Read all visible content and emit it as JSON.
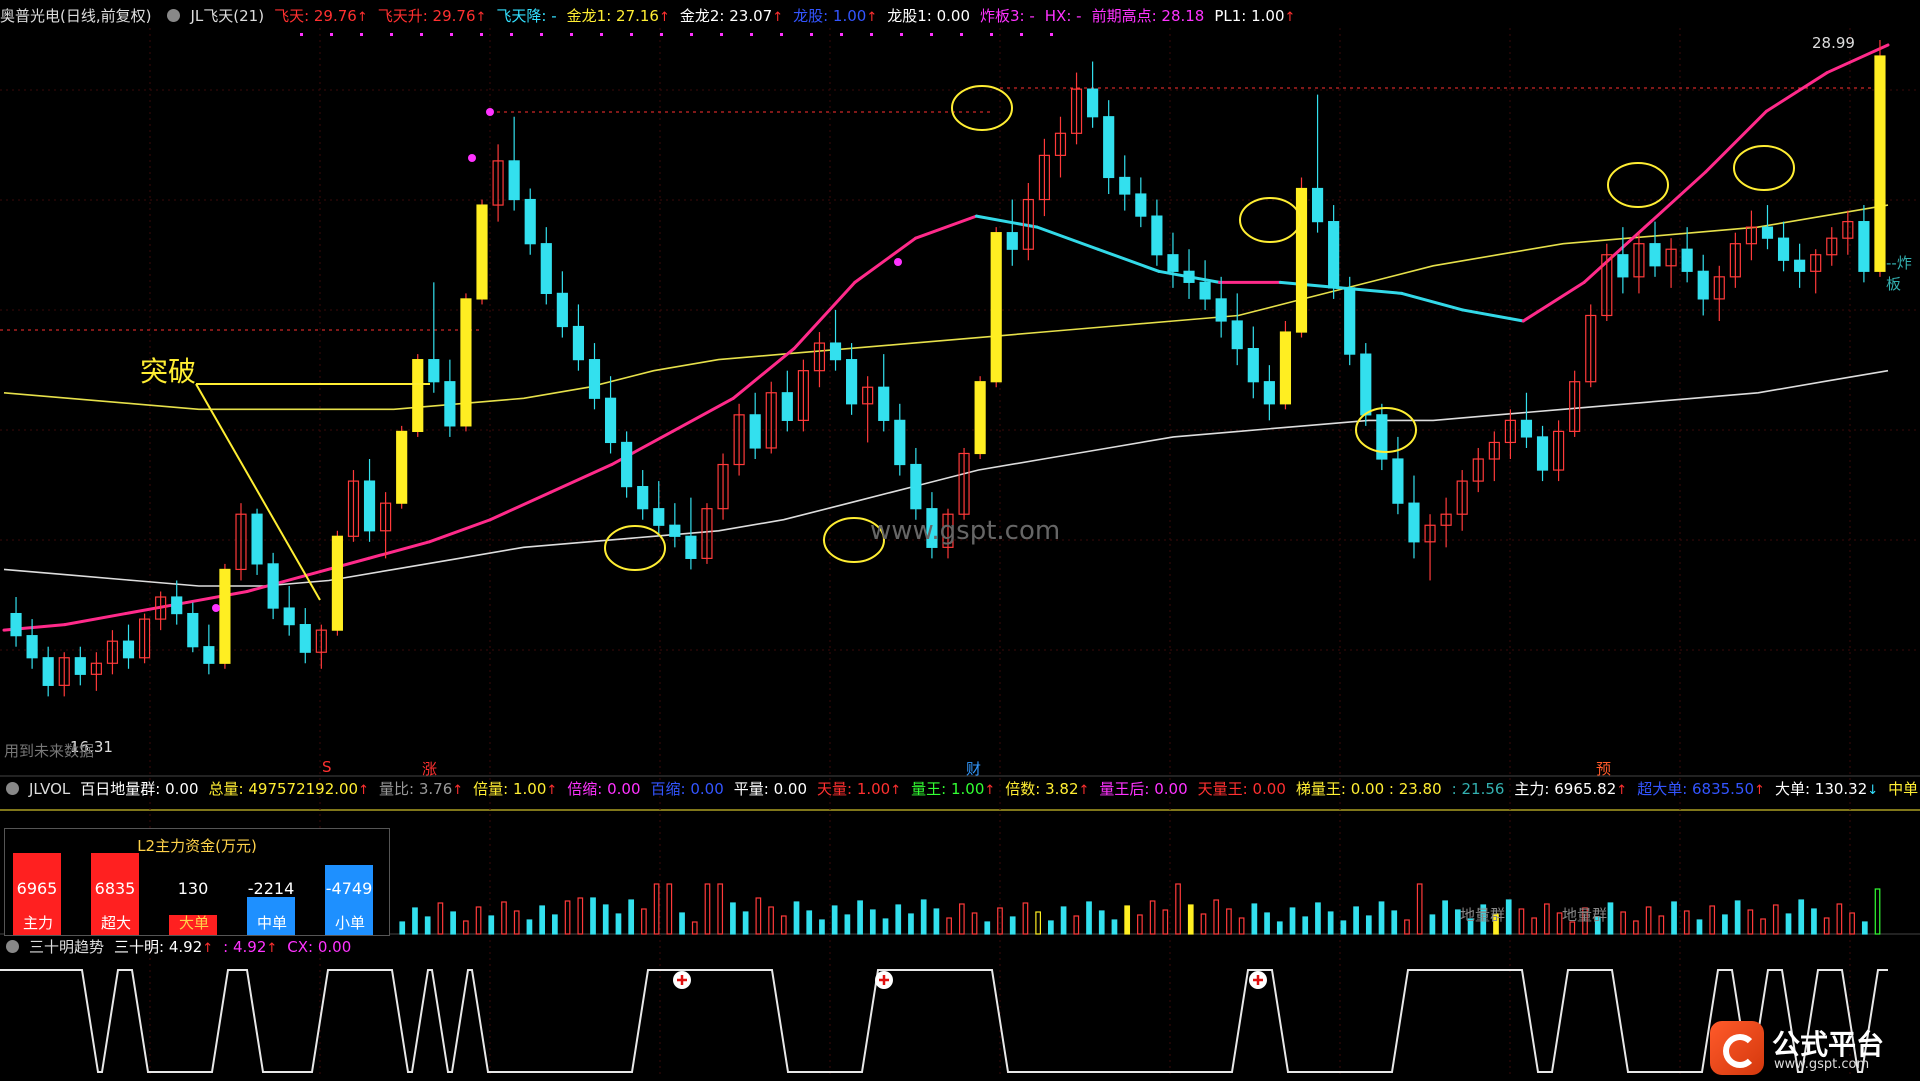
{
  "header": {
    "stock": "奥普光电(日线,前复权)",
    "indicator": "JL飞天(21)",
    "items": [
      {
        "label": "飞天: 29.76",
        "color": "#ff3030",
        "arrow": "↑"
      },
      {
        "label": "飞天升: 29.76",
        "color": "#ff3030",
        "arrow": "↑"
      },
      {
        "label": "飞天降: -",
        "color": "#33e0ff",
        "arrow": ""
      },
      {
        "label": "金龙1: 27.16",
        "color": "#ffee33",
        "arrow": "↑"
      },
      {
        "label": "金龙2: 23.07",
        "color": "#ffffff",
        "arrow": "↑"
      },
      {
        "label": "龙股: 1.00",
        "color": "#3355ff",
        "arrow": "↑"
      },
      {
        "label": "龙股1: 0.00",
        "color": "#ffffff",
        "arrow": ""
      },
      {
        "label": "炸板3: -",
        "color": "#ff33ff",
        "arrow": ""
      },
      {
        "label": "HX: -",
        "color": "#ff33ff",
        "arrow": ""
      },
      {
        "label": "前期高点: 28.18",
        "color": "#ff33ff",
        "arrow": ""
      },
      {
        "label": "PL1: 1.00",
        "color": "#ffffff",
        "arrow": "↑"
      }
    ]
  },
  "main": {
    "price_label": "28.99",
    "low_label": "16.31",
    "left_note": "用到未来数据",
    "right_note": "--炸板",
    "annotation": "突破",
    "watermark": "www.gspt.com",
    "markers": [
      {
        "text": "S",
        "color": "#ff3030"
      },
      {
        "text": "涨",
        "color": "#ff3030"
      },
      {
        "text": "财",
        "color": "#3399ff"
      },
      {
        "text": "预",
        "color": "#ff5a2a"
      }
    ]
  },
  "volume_header": {
    "name": "JLVOL",
    "items": [
      {
        "label": "百日地量群: 0.00",
        "color": "#ffffff",
        "arrow": ""
      },
      {
        "label": "总量: 497572192.00",
        "color": "#ffee33",
        "arrow": "↑"
      },
      {
        "label": "量比: 3.76",
        "color": "#999999",
        "arrow": "↑"
      },
      {
        "label": "倍量: 1.00",
        "color": "#ffee33",
        "arrow": "↑"
      },
      {
        "label": "倍缩: 0.00",
        "color": "#ff33ff",
        "arrow": ""
      },
      {
        "label": "百缩: 0.00",
        "color": "#3355ff",
        "arrow": ""
      },
      {
        "label": "平量: 0.00",
        "color": "#ffffff",
        "arrow": ""
      },
      {
        "label": "天量: 1.00",
        "color": "#ff3030",
        "arrow": "↑"
      },
      {
        "label": "量王: 1.00",
        "color": "#33ff33",
        "arrow": "↑"
      },
      {
        "label": "倍数: 3.82",
        "color": "#ffee33",
        "arrow": "↑"
      },
      {
        "label": "量王后: 0.00",
        "color": "#ff33ff",
        "arrow": ""
      },
      {
        "label": "天量王: 0.00",
        "color": "#ff3030",
        "arrow": ""
      },
      {
        "label": "梯量王: 0.00 : 23.80",
        "color": "#ffee33",
        "arrow": ""
      },
      {
        "label": ": 21.56",
        "color": "#33b0b0",
        "arrow": ""
      },
      {
        "label": "主力: 6965.82",
        "color": "#ffffff",
        "arrow": "↑"
      },
      {
        "label": "超大单: 6835.50",
        "color": "#3355ff",
        "arrow": "↑"
      },
      {
        "label": "大单: 130.32",
        "color": "#ffffff",
        "arrow": "↓"
      },
      {
        "label": "中单",
        "color": "#ffee33",
        "arrow": ""
      }
    ]
  },
  "l2_panel": {
    "title": "L2主力资金(万元)",
    "bars": [
      {
        "label": "主力",
        "value": "6965",
        "color": "#ff2020"
      },
      {
        "label": "超大",
        "value": "6835",
        "color": "#ff2020"
      },
      {
        "label": "大单",
        "value": "130",
        "color": "#ff2020"
      },
      {
        "label": "中单",
        "value": "-2214",
        "color": "#1e90ff"
      },
      {
        "label": "小单",
        "value": "-4749",
        "color": "#1e90ff"
      }
    ],
    "land_labels": [
      "地量群",
      "地量群"
    ]
  },
  "trend_header": {
    "name": "三十明趋势",
    "items": [
      {
        "label": "三十明: 4.92",
        "color": "#ffffff",
        "arrow": "↑"
      },
      {
        "label": ": 4.92",
        "color": "#ff33ff",
        "arrow": "↑"
      },
      {
        "label": "CX: 0.00",
        "color": "#ff33ff",
        "arrow": ""
      }
    ]
  },
  "logo": {
    "name": "公式平台",
    "url": "www.gspt.com"
  },
  "chart_data": {
    "type": "candlestick",
    "ylim": [
      16.31,
      28.99
    ],
    "candles": [
      [
        18.6,
        18.9,
        18.0,
        18.2
      ],
      [
        18.2,
        18.5,
        17.6,
        17.8
      ],
      [
        17.8,
        18.0,
        17.1,
        17.3
      ],
      [
        17.3,
        17.9,
        17.1,
        17.8
      ],
      [
        17.8,
        18.0,
        17.3,
        17.5
      ],
      [
        17.5,
        17.9,
        17.2,
        17.7
      ],
      [
        17.7,
        18.3,
        17.5,
        18.1
      ],
      [
        18.1,
        18.4,
        17.6,
        17.8
      ],
      [
        17.8,
        18.6,
        17.7,
        18.5
      ],
      [
        18.5,
        19.0,
        18.3,
        18.9
      ],
      [
        18.9,
        19.2,
        18.4,
        18.6
      ],
      [
        18.6,
        18.8,
        17.9,
        18.0
      ],
      [
        18.0,
        18.4,
        17.5,
        17.7
      ],
      [
        17.7,
        19.5,
        17.6,
        19.4
      ],
      [
        19.4,
        20.6,
        19.2,
        20.4
      ],
      [
        20.4,
        20.5,
        19.3,
        19.5
      ],
      [
        19.5,
        19.7,
        18.5,
        18.7
      ],
      [
        18.7,
        19.1,
        18.2,
        18.4
      ],
      [
        18.4,
        18.7,
        17.7,
        17.9
      ],
      [
        17.9,
        18.4,
        17.6,
        18.3
      ],
      [
        18.3,
        20.1,
        18.2,
        20.0
      ],
      [
        20.0,
        21.2,
        19.9,
        21.0
      ],
      [
        21.0,
        21.4,
        19.9,
        20.1
      ],
      [
        20.1,
        20.8,
        19.6,
        20.6
      ],
      [
        20.6,
        22.0,
        20.5,
        21.9
      ],
      [
        21.9,
        23.3,
        21.8,
        23.2
      ],
      [
        23.2,
        24.6,
        22.6,
        22.8
      ],
      [
        22.8,
        23.2,
        21.8,
        22.0
      ],
      [
        22.0,
        24.4,
        21.9,
        24.3
      ],
      [
        24.3,
        26.1,
        24.2,
        26.0
      ],
      [
        26.0,
        27.1,
        25.7,
        26.8
      ],
      [
        26.8,
        27.6,
        25.9,
        26.1
      ],
      [
        26.1,
        26.3,
        25.1,
        25.3
      ],
      [
        25.3,
        25.6,
        24.2,
        24.4
      ],
      [
        24.4,
        24.8,
        23.6,
        23.8
      ],
      [
        23.8,
        24.2,
        23.0,
        23.2
      ],
      [
        23.2,
        23.5,
        22.3,
        22.5
      ],
      [
        22.5,
        22.9,
        21.5,
        21.7
      ],
      [
        21.7,
        21.9,
        20.7,
        20.9
      ],
      [
        20.9,
        21.2,
        20.3,
        20.5
      ],
      [
        20.5,
        21.0,
        20.0,
        20.2
      ],
      [
        20.2,
        20.6,
        19.8,
        20.0
      ],
      [
        20.0,
        20.7,
        19.4,
        19.6
      ],
      [
        19.6,
        20.6,
        19.5,
        20.5
      ],
      [
        20.5,
        21.5,
        20.3,
        21.3
      ],
      [
        21.3,
        22.4,
        21.1,
        22.2
      ],
      [
        22.2,
        22.6,
        21.4,
        21.6
      ],
      [
        21.6,
        22.8,
        21.5,
        22.6
      ],
      [
        22.6,
        23.0,
        21.9,
        22.1
      ],
      [
        22.1,
        23.2,
        21.9,
        23.0
      ],
      [
        23.0,
        23.7,
        22.7,
        23.5
      ],
      [
        23.5,
        24.1,
        23.0,
        23.2
      ],
      [
        23.2,
        23.5,
        22.2,
        22.4
      ],
      [
        22.4,
        22.9,
        21.7,
        22.7
      ],
      [
        22.7,
        23.3,
        21.9,
        22.1
      ],
      [
        22.1,
        22.4,
        21.1,
        21.3
      ],
      [
        21.3,
        21.6,
        20.3,
        20.5
      ],
      [
        20.5,
        20.8,
        19.6,
        19.8
      ],
      [
        19.8,
        20.5,
        19.6,
        20.4
      ],
      [
        20.4,
        21.6,
        20.3,
        21.5
      ],
      [
        21.5,
        22.9,
        21.4,
        22.8
      ],
      [
        22.8,
        25.6,
        22.7,
        25.5
      ],
      [
        25.5,
        26.1,
        24.9,
        25.2
      ],
      [
        25.2,
        26.4,
        25.0,
        26.1
      ],
      [
        26.1,
        27.2,
        25.8,
        26.9
      ],
      [
        26.9,
        27.6,
        26.5,
        27.3
      ],
      [
        27.3,
        28.4,
        27.1,
        28.1
      ],
      [
        28.1,
        28.6,
        27.4,
        27.6
      ],
      [
        27.6,
        27.9,
        26.2,
        26.5
      ],
      [
        26.5,
        26.9,
        25.9,
        26.2
      ],
      [
        26.2,
        26.5,
        25.6,
        25.8
      ],
      [
        25.8,
        26.1,
        24.9,
        25.1
      ],
      [
        25.1,
        25.5,
        24.5,
        24.8
      ],
      [
        24.8,
        25.2,
        24.3,
        24.6
      ],
      [
        24.6,
        25.0,
        24.1,
        24.3
      ],
      [
        24.3,
        24.7,
        23.6,
        23.9
      ],
      [
        23.9,
        24.4,
        23.1,
        23.4
      ],
      [
        23.4,
        23.8,
        22.5,
        22.8
      ],
      [
        22.8,
        23.1,
        22.1,
        22.4
      ],
      [
        22.4,
        23.9,
        22.3,
        23.7
      ],
      [
        23.7,
        26.5,
        23.6,
        26.3
      ],
      [
        26.3,
        28.0,
        25.5,
        25.7
      ],
      [
        25.7,
        26.0,
        24.3,
        24.5
      ],
      [
        24.5,
        24.7,
        23.1,
        23.3
      ],
      [
        23.3,
        23.5,
        22.0,
        22.2
      ],
      [
        22.2,
        22.4,
        21.2,
        21.4
      ],
      [
        21.4,
        21.8,
        20.4,
        20.6
      ],
      [
        20.6,
        21.1,
        19.6,
        19.9
      ],
      [
        19.9,
        20.4,
        19.2,
        20.2
      ],
      [
        20.2,
        20.7,
        19.8,
        20.4
      ],
      [
        20.4,
        21.2,
        20.1,
        21.0
      ],
      [
        21.0,
        21.6,
        20.8,
        21.4
      ],
      [
        21.4,
        21.9,
        21.0,
        21.7
      ],
      [
        21.7,
        22.3,
        21.4,
        22.1
      ],
      [
        22.1,
        22.6,
        21.6,
        21.8
      ],
      [
        21.8,
        22.0,
        21.0,
        21.2
      ],
      [
        21.2,
        22.1,
        21.0,
        21.9
      ],
      [
        21.9,
        23.0,
        21.8,
        22.8
      ],
      [
        22.8,
        24.2,
        22.7,
        24.0
      ],
      [
        24.0,
        25.3,
        23.9,
        25.1
      ],
      [
        25.1,
        25.6,
        24.4,
        24.7
      ],
      [
        24.7,
        25.5,
        24.4,
        25.3
      ],
      [
        25.3,
        25.7,
        24.7,
        24.9
      ],
      [
        24.9,
        25.4,
        24.5,
        25.2
      ],
      [
        25.2,
        25.6,
        24.6,
        24.8
      ],
      [
        24.8,
        25.1,
        24.0,
        24.3
      ],
      [
        24.3,
        24.9,
        23.9,
        24.7
      ],
      [
        24.7,
        25.5,
        24.5,
        25.3
      ],
      [
        25.3,
        25.9,
        25.0,
        25.6
      ],
      [
        25.6,
        26.0,
        25.2,
        25.4
      ],
      [
        25.4,
        25.7,
        24.8,
        25.0
      ],
      [
        25.0,
        25.3,
        24.5,
        24.8
      ],
      [
        24.8,
        25.2,
        24.4,
        25.1
      ],
      [
        25.1,
        25.6,
        24.9,
        25.4
      ],
      [
        25.4,
        25.9,
        25.1,
        25.7
      ],
      [
        25.7,
        26.0,
        24.6,
        24.8
      ],
      [
        24.8,
        28.99,
        24.7,
        28.7
      ]
    ],
    "series": [
      {
        "values": [
          18.3,
          18.4,
          18.6,
          18.8,
          19.0,
          19.3,
          19.6,
          19.9,
          20.3,
          20.8,
          21.3,
          21.9,
          22.5,
          23.4,
          24.6,
          25.4,
          25.8,
          25.6,
          25.2,
          24.8,
          24.6,
          24.6,
          24.5,
          24.4,
          24.1,
          23.9,
          24.6,
          25.6,
          26.6,
          27.7,
          28.4,
          28.9
        ]
      },
      {
        "values": [
          22.6,
          22.5,
          22.4,
          22.3,
          22.3,
          22.3,
          22.3,
          22.4,
          22.5,
          22.7,
          23.0,
          23.2,
          23.3,
          23.4,
          23.5,
          23.6,
          23.7,
          23.8,
          23.9,
          24.0,
          24.3,
          24.6,
          24.9,
          25.1,
          25.3,
          25.4,
          25.5,
          25.6,
          25.8,
          26.0
        ]
      },
      {
        "values": [
          19.4,
          19.3,
          19.2,
          19.1,
          19.1,
          19.2,
          19.4,
          19.6,
          19.8,
          19.9,
          20.0,
          20.1,
          20.3,
          20.6,
          20.9,
          21.2,
          21.4,
          21.6,
          21.8,
          21.9,
          22.0,
          22.1,
          22.1,
          22.2,
          22.3,
          22.4,
          22.5,
          22.6,
          22.8,
          23.0
        ]
      }
    ],
    "annotations": [
      {
        "text": "突破",
        "x": 10,
        "y": 22.4
      }
    ]
  }
}
